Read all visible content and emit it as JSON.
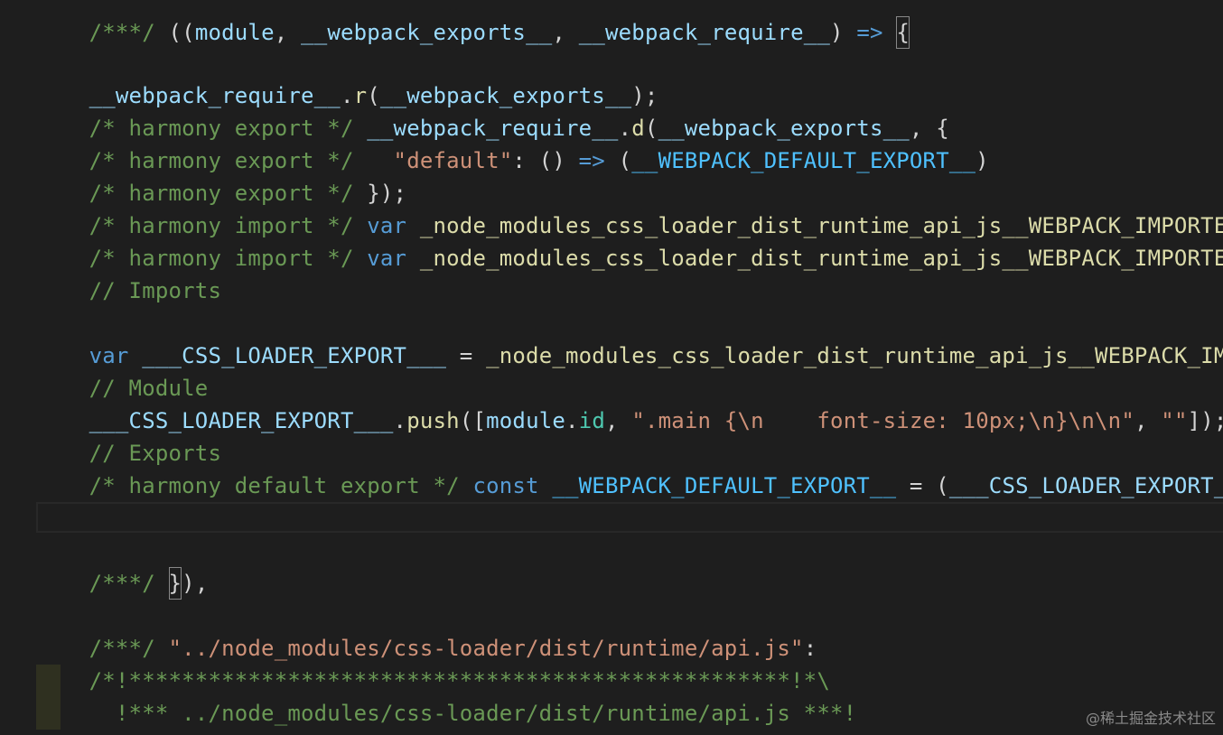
{
  "editor": {
    "background": "#1e1e1e",
    "colors": {
      "comment": "#6a9955",
      "function": "#dcdcaa",
      "variable": "#9cdcfe",
      "keyword": "#569cd6",
      "string": "#ce9178",
      "constant": "#4fc1ff",
      "property": "#4ec9b0"
    },
    "lines": {
      "l0": {
        "t1": "/***/ ",
        "t2": "((",
        "t3": "module",
        "t4": ", ",
        "t5": "__webpack_exports__",
        "t6": ", ",
        "t7": "__webpack_require__",
        "t8": ") ",
        "t9": "=>",
        "t10": " ",
        "t11": "{"
      },
      "l2": {
        "t1": "__webpack_require__",
        "t2": ".",
        "t3": "r",
        "t4": "(",
        "t5": "__webpack_exports__",
        "t6": ");"
      },
      "l3": {
        "t1": "/* harmony export */ ",
        "t2": "__webpack_require__",
        "t3": ".",
        "t4": "d",
        "t5": "(",
        "t6": "__webpack_exports__",
        "t7": ", {"
      },
      "l4": {
        "t1": "/* harmony export */   ",
        "t2": "\"default\"",
        "t3": ": () ",
        "t4": "=>",
        "t5": " (",
        "t6": "__WEBPACK_DEFAULT_EXPORT__",
        "t7": ")"
      },
      "l5": {
        "t1": "/* harmony export */ ",
        "t2": "});"
      },
      "l6": {
        "t1": "/* harmony import */ ",
        "t2": "var",
        "t3": " ",
        "t4": "_node_modules_css_loader_dist_runtime_api_js__WEBPACK_IMPORTED_MOD"
      },
      "l7": {
        "t1": "/* harmony import */ ",
        "t2": "var",
        "t3": " ",
        "t4": "_node_modules_css_loader_dist_runtime_api_js__WEBPACK_IMPORTED_MOD"
      },
      "l8": {
        "t1": "// Imports"
      },
      "l10": {
        "t1": "var",
        "t2": " ",
        "t3": "___CSS_LOADER_EXPORT___",
        "t4": " = ",
        "t5": "_node_modules_css_loader_dist_runtime_api_js__WEBPACK_IMPORTE"
      },
      "l11": {
        "t1": "// Module"
      },
      "l12": {
        "t1": "___CSS_LOADER_EXPORT___",
        "t2": ".",
        "t3": "push",
        "t4": "([",
        "t5": "module",
        "t6": ".",
        "t7": "id",
        "t8": ", ",
        "t9": "\".main {\\n    font-size: 10px;\\n}\\n\\n\"",
        "t10": ", ",
        "t11": "\"\"",
        "t12": "]);"
      },
      "l13": {
        "t1": "// Exports"
      },
      "l14": {
        "t1": "/* harmony default export */ ",
        "t2": "const",
        "t3": " ",
        "t4": "__WEBPACK_DEFAULT_EXPORT__",
        "t5": " = (",
        "t6": "___CSS_LOADER_EXPORT___",
        "t7": ");"
      },
      "l17": {
        "t1": "/***/ ",
        "t2": "}",
        "t3": "),"
      },
      "l19": {
        "t1": "/***/ ",
        "t2": "\"../node_modules/css-loader/dist/runtime/api.js\"",
        "t3": ":"
      },
      "l20": {
        "t1": "/*!**************************************************!*\\"
      },
      "l21": {
        "t1": "  !*** ../node_modules/css-loader/dist/runtime/api.js ***!"
      },
      "l22": {
        "t1": "  \\**************************************************/"
      }
    }
  },
  "watermark": {
    "text": "@稀土掘金技术社区"
  }
}
